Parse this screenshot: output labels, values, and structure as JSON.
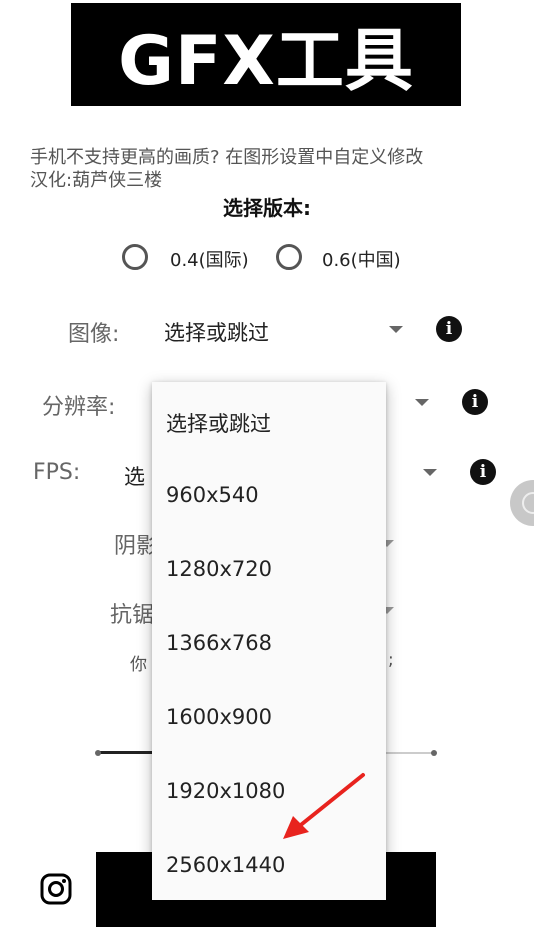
{
  "banner": {
    "title": "GFX工具"
  },
  "info": {
    "line1": "手机不支持更高的画质? 在图形设置中自定义修改",
    "line2": "汉化:葫芦侠三楼"
  },
  "version": {
    "title": "选择版本:",
    "options": [
      "0.4(国际)",
      "0.6(中国)"
    ]
  },
  "settings": {
    "graphics": {
      "label": "图像:",
      "value": "选择或跳过"
    },
    "resolution": {
      "label": "分辨率:"
    },
    "fps": {
      "label": "FPS:",
      "value_partial": "选"
    },
    "shadow": {
      "label_partial": "阴影"
    },
    "antialias": {
      "label_partial": "抗锯"
    },
    "hint_partial_left": "你",
    "hint_partial_right": ";"
  },
  "dropdown": {
    "items": [
      "选择或跳过",
      "960x540",
      "1280x720",
      "1366x768",
      "1600x900",
      "1920x1080",
      "2560x1440"
    ]
  },
  "colors": {
    "arrow": "#e8231e",
    "banner_bg": "#000000"
  },
  "icons": {
    "info": "info-icon",
    "instagram": "instagram-icon"
  }
}
